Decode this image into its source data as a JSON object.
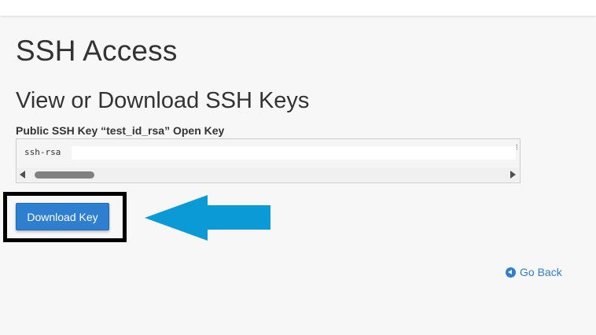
{
  "page": {
    "title": "SSH Access"
  },
  "section": {
    "title": "View or Download SSH Keys"
  },
  "key": {
    "label": "Public SSH Key “test_id_rsa” Open Key",
    "value": "ssh-rsa"
  },
  "actions": {
    "download_label": "Download Key",
    "go_back_label": "Go Back"
  },
  "icons": {
    "scroll_left": "triangle-left-icon",
    "scroll_right": "triangle-right-icon",
    "go_back": "circle-arrow-left-icon",
    "annotation": "left-arrow-icon"
  },
  "colors": {
    "accent": "#2f7fd1",
    "annotation_arrow": "#0c9ad6",
    "highlight_border": "#000000"
  }
}
